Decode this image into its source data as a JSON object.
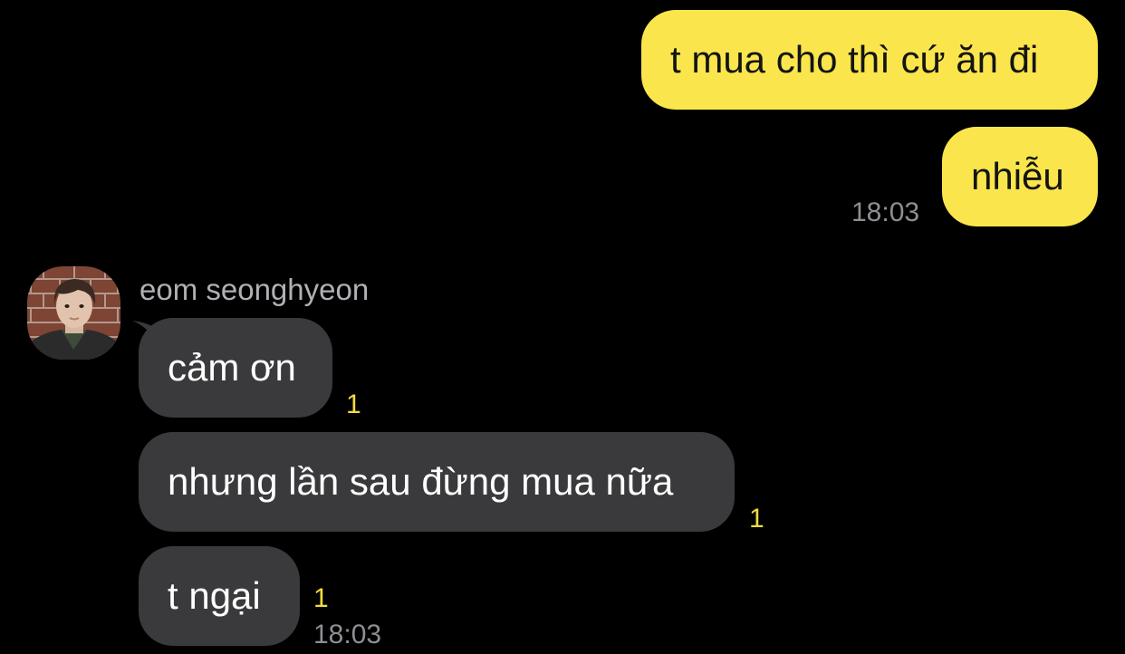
{
  "outgoing": [
    {
      "text": "t mua cho thì cứ ăn đi"
    },
    {
      "text": "nhiễu",
      "time": "18:03"
    }
  ],
  "incoming": {
    "sender_name": "eom seonghyeon",
    "avatar_icon": "profile-photo",
    "messages": [
      {
        "text": "cảm ơn",
        "unread": "1"
      },
      {
        "text": "nhưng lần sau đừng mua nữa",
        "unread": "1"
      },
      {
        "text": "t ngại",
        "unread": "1",
        "time": "18:03"
      }
    ]
  },
  "colors": {
    "background": "#000000",
    "outgoing_bubble": "#fae64c",
    "incoming_bubble": "#3a3a3c",
    "unread_count": "#f2dc3d",
    "timestamp": "#8e8e93"
  }
}
